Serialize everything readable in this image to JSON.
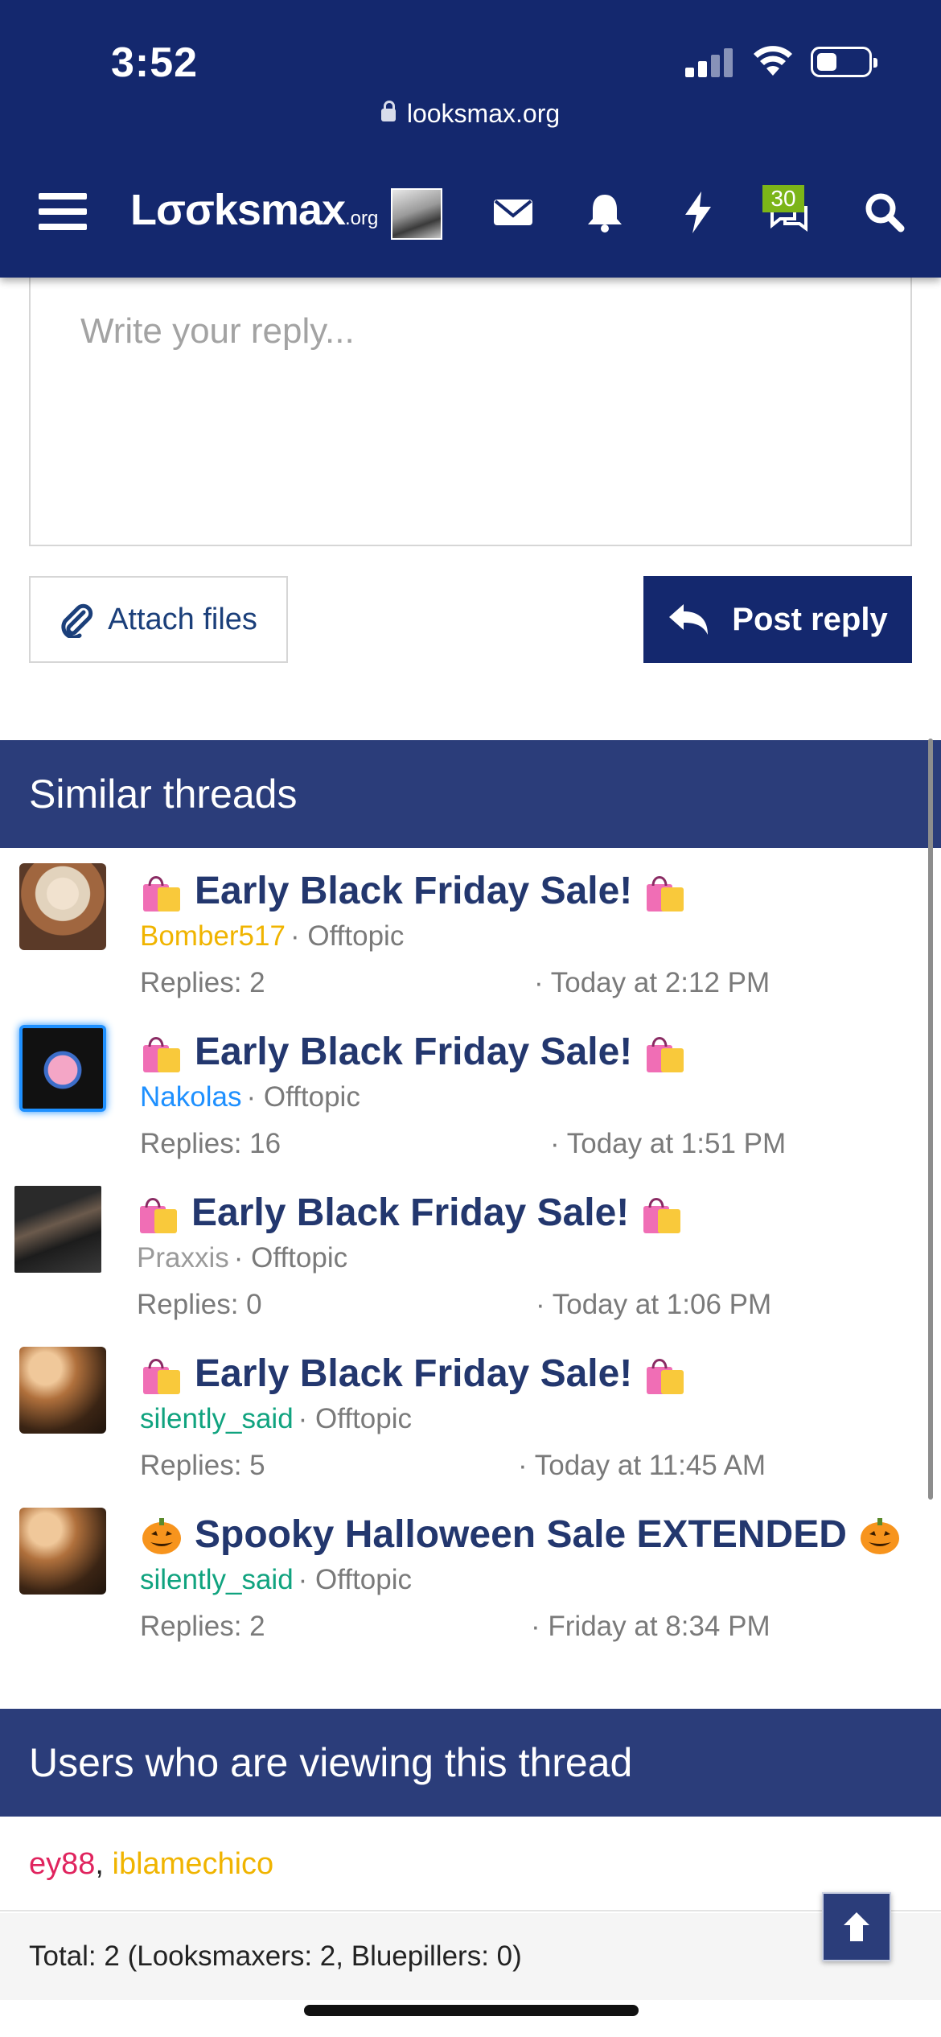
{
  "status_bar": {
    "time": "3:52",
    "url": "looksmax.org"
  },
  "nav": {
    "logo_main": "Lσσksmax",
    "logo_suffix": ".org",
    "conversations_badge": "30"
  },
  "reply": {
    "placeholder": "Write your reply...",
    "attach_label": "Attach files",
    "post_label": "Post reply"
  },
  "similar": {
    "heading": "Similar threads",
    "threads": [
      {
        "icon": "shopping-bags-emoji",
        "title": "Early Black Friday Sale!",
        "user": "Bomber517",
        "user_color": "#f0b400",
        "forum": "Offtopic",
        "replies": "Replies: 2",
        "date": "Today at 2:12 PM"
      },
      {
        "icon": "shopping-bags-emoji",
        "title": "Early Black Friday Sale!",
        "user": "Nakolas",
        "user_color": "#1e90ff",
        "forum": "Offtopic",
        "replies": "Replies: 16",
        "date": "Today at 1:51 PM"
      },
      {
        "icon": "shopping-bags-emoji",
        "title": "Early Black Friday Sale!",
        "user": "Praxxis",
        "user_color": "#9a9a9a",
        "forum": "Offtopic",
        "replies": "Replies: 0",
        "date": "Today at 1:06 PM"
      },
      {
        "icon": "shopping-bags-emoji",
        "title": "Early Black Friday Sale!",
        "user": "silently_said",
        "user_color": "#10a37f",
        "forum": "Offtopic",
        "replies": "Replies: 5",
        "date": "Today at 11:45 AM"
      },
      {
        "icon": "pumpkin-emoji",
        "title": "Spooky Halloween Sale EXTENDED",
        "user": "silently_said",
        "user_color": "#10a37f",
        "forum": "Offtopic",
        "replies": "Replies: 2",
        "date": "Friday at 8:34 PM"
      }
    ]
  },
  "viewers": {
    "heading": "Users who are viewing this thread",
    "users": [
      {
        "name": "ey88",
        "color": "#e0245e"
      },
      {
        "name": "iblamechico",
        "color": "#f0b400"
      }
    ],
    "separator": ", ",
    "total": "Total: 2 (Looksmaxers: 2, Bluepillers: 0)"
  },
  "colors": {
    "header_bg": "#14286e",
    "section_bg": "#2b3d7a",
    "title_color": "#23376e"
  }
}
